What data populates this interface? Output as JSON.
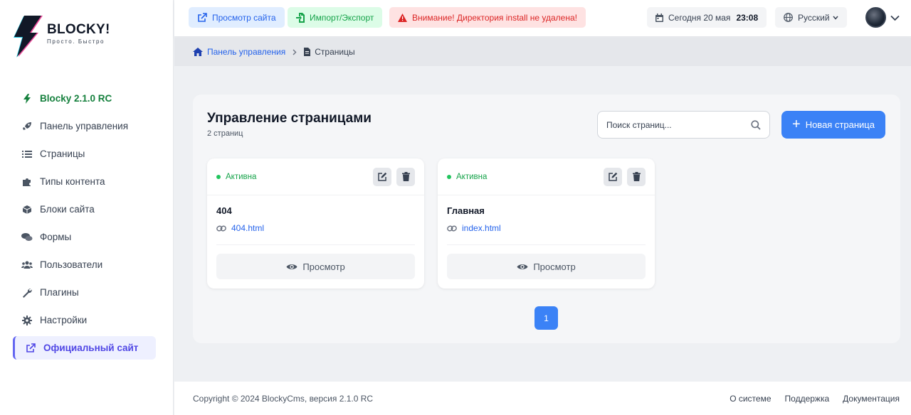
{
  "brand": {
    "name": "BLOCKY!",
    "tagline": "Просто. Быстро"
  },
  "sidebar": {
    "items": [
      {
        "label": "Blocky 2.1.0 RC",
        "icon": "bolt-icon"
      },
      {
        "label": "Панель управления",
        "icon": "rocket-icon"
      },
      {
        "label": "Страницы",
        "icon": "list-icon"
      },
      {
        "label": "Типы контента",
        "icon": "puzzle-icon"
      },
      {
        "label": "Блоки сайта",
        "icon": "cube-icon"
      },
      {
        "label": "Формы",
        "icon": "comments-icon"
      },
      {
        "label": "Пользователи",
        "icon": "users-icon"
      },
      {
        "label": "Плагины",
        "icon": "wrench-icon"
      },
      {
        "label": "Настройки",
        "icon": "gear-icon"
      },
      {
        "label": "Официальный сайт",
        "icon": "external-link-icon"
      }
    ]
  },
  "topbar": {
    "view_site": "Просмотр сайта",
    "import_export": "Импорт/Экспорт",
    "warning": "Внимание! Директория install не удалена!",
    "date": "Сегодня 20 мая",
    "time": "23:08",
    "language": "Русский"
  },
  "breadcrumb": {
    "home": "Панель управления",
    "current": "Страницы"
  },
  "main": {
    "title": "Управление страницами",
    "count": "2 страниц",
    "search_placeholder": "Поиск страниц...",
    "new_page": "Новая страница",
    "cards": [
      {
        "status": "Активна",
        "name": "404",
        "link": "404.html",
        "view": "Просмотр"
      },
      {
        "status": "Активна",
        "name": "Главная",
        "link": "index.html",
        "view": "Просмотр"
      }
    ],
    "pagination": {
      "current": "1"
    }
  },
  "footer": {
    "copyright": "Copyright © 2024 BlockyCms, версия 2.1.0 RC",
    "links": [
      "О системе",
      "Поддержка",
      "Документация"
    ]
  },
  "colors": {
    "primary": "#3b82f6",
    "success": "#16a34a",
    "danger": "#dc2626",
    "accent": "#6366f1"
  }
}
